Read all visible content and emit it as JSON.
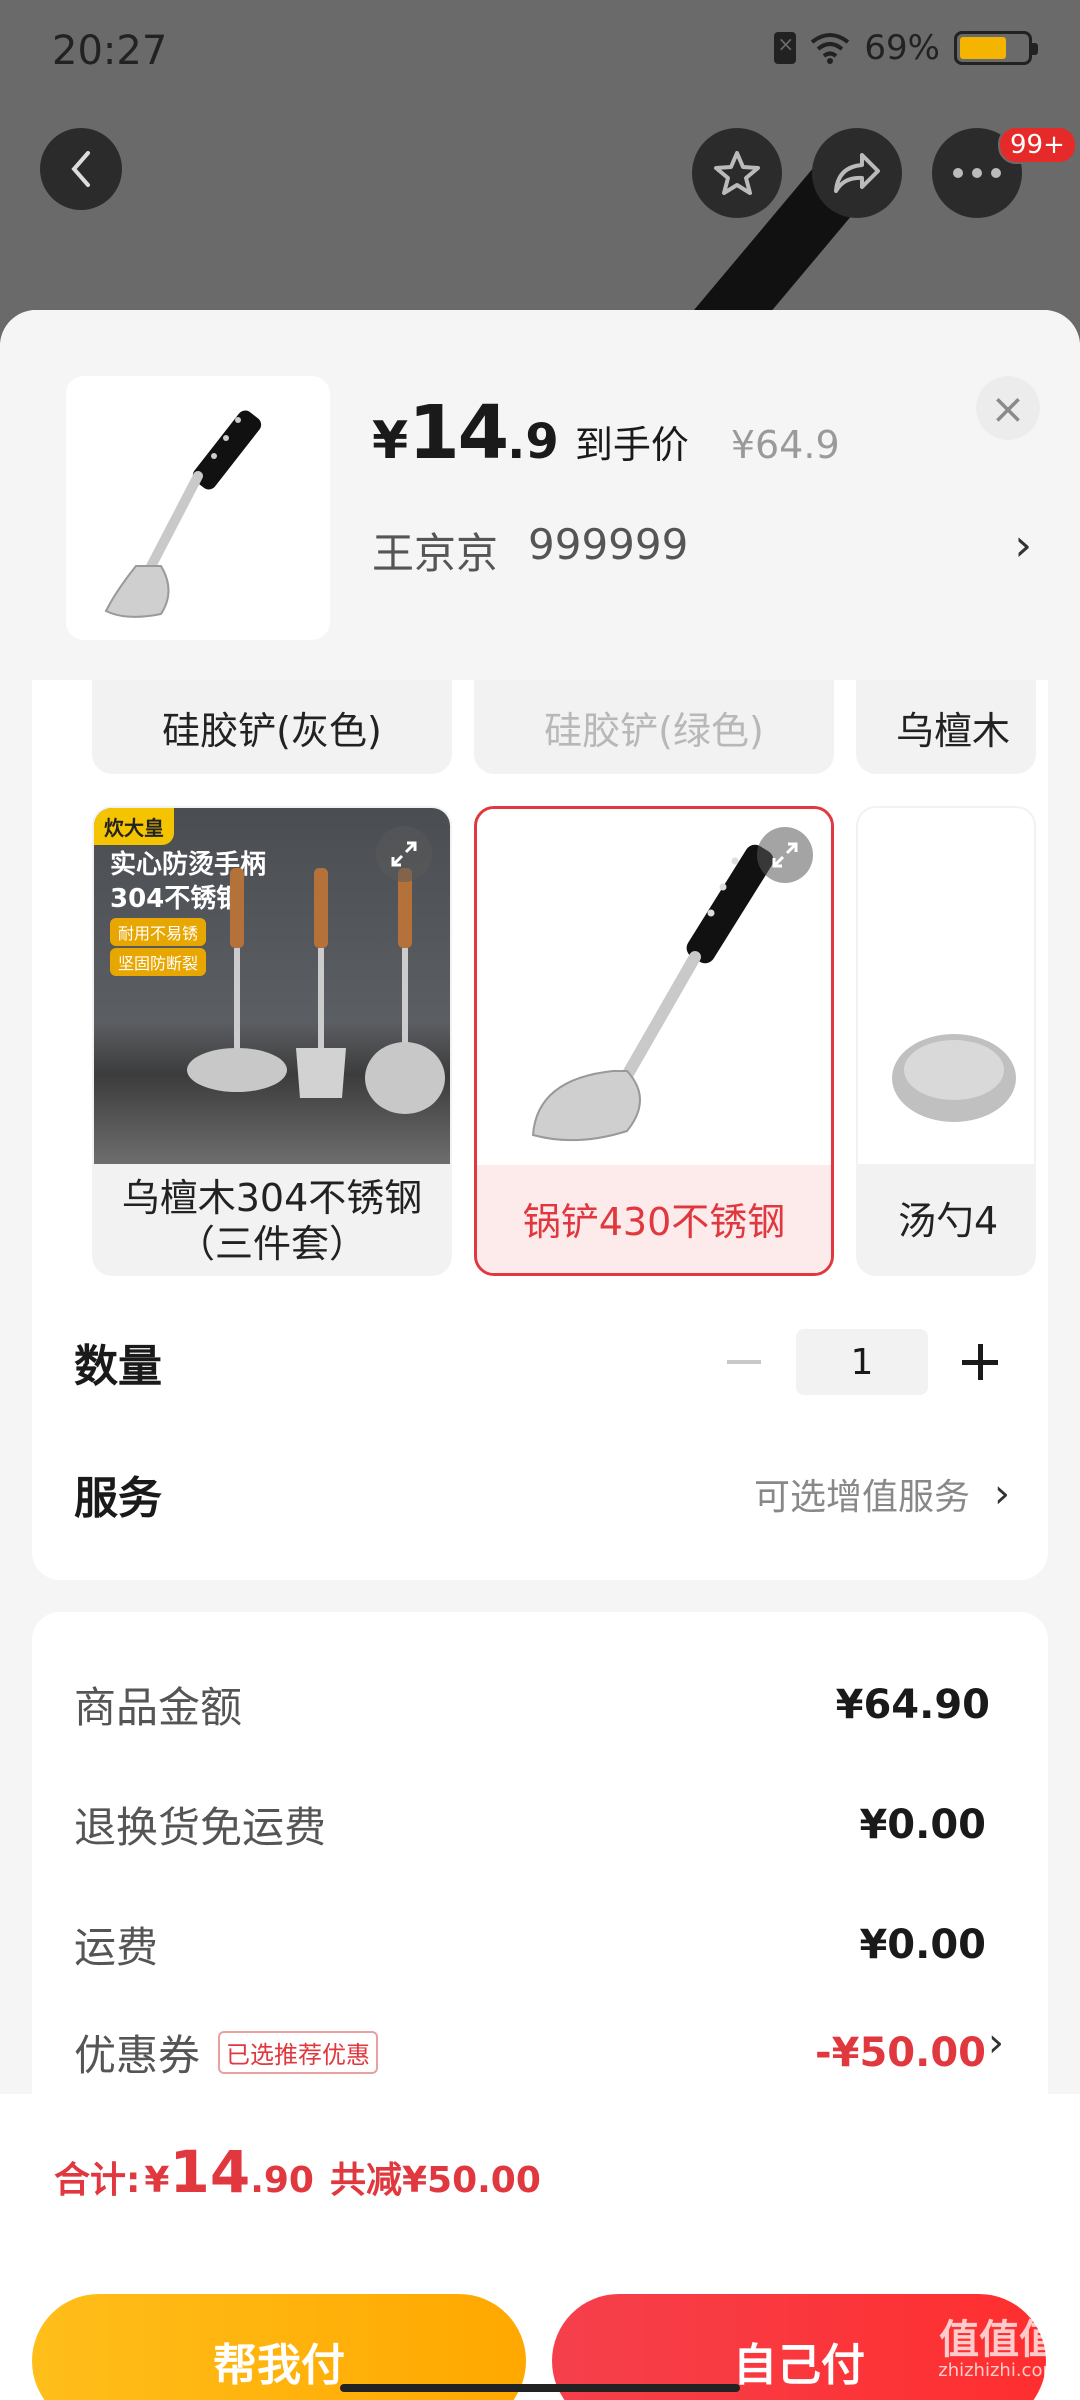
{
  "status_bar": {
    "time": "20:27",
    "battery": "69%"
  },
  "header": {
    "badge": "99+"
  },
  "product": {
    "currency": "¥",
    "price_int": "14",
    "price_dec": ".9",
    "price_label": "到手价",
    "original_price": "¥64.9",
    "recipient_name": "王京京",
    "recipient_phone": "999999"
  },
  "options": {
    "row1": [
      "硅胶铲(灰色)",
      "硅胶铲(绿色)",
      "乌檀木"
    ],
    "cards": [
      {
        "label": "乌檀木304不锈钢（三件套）",
        "brand": "炊大皇",
        "promo": "实心防烫手柄",
        "promo2": "304不锈钢",
        "tag1": "耐用不易锈",
        "tag2": "坚固防断裂"
      },
      {
        "label": "锅铲430不锈钢"
      },
      {
        "label": "汤勺4"
      }
    ]
  },
  "quantity": {
    "label": "数量",
    "value": "1"
  },
  "service": {
    "label": "服务",
    "value": "可选增值服务"
  },
  "summary": {
    "rows": [
      {
        "label": "商品金额",
        "value": "¥64.90"
      },
      {
        "label": "退换货免运费",
        "value": "¥0.00"
      },
      {
        "label": "运费",
        "value": "¥0.00"
      },
      {
        "label": "优惠券",
        "tag": "已选推荐优惠",
        "value": "-¥50.00"
      }
    ]
  },
  "footer": {
    "total_label": "合计:",
    "total_sym": "¥",
    "total_int": "14",
    "total_dec": ".90",
    "total_save": "共减¥50.00",
    "pay_friend": "帮我付",
    "pay_self": "自己付"
  },
  "watermark": {
    "main": "值值值",
    "sub": "zhizhizhi.com"
  },
  "colors": {
    "accent_red": "#e0383e",
    "friend_pay": "#ffb20d",
    "self_pay": "#f5404c"
  }
}
